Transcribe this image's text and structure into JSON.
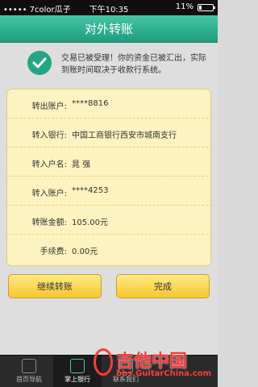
{
  "status_bar": {
    "carrier": "••••• 7color瓜子",
    "time": "下午10:35",
    "battery": "11%"
  },
  "header": {
    "title": "对外转账"
  },
  "notice": {
    "text": "交易已被受理！你的资金已被汇出，实际到账时间取决于收款行系统。"
  },
  "transfer": {
    "rows": [
      {
        "label": "转出账户:",
        "value": "****8816"
      },
      {
        "label": "转入银行:",
        "value": "中国工商银行西安市城南支行"
      },
      {
        "label": "转入户名:",
        "value": "晁 强"
      },
      {
        "label": "转入账户:",
        "value": "****4253"
      },
      {
        "label": "转账金额:",
        "value": "105.00元"
      },
      {
        "label": "手续费:",
        "value": "0.00元"
      }
    ]
  },
  "buttons": {
    "continue_label": "继续转账",
    "done_label": "完成"
  },
  "tabbar": {
    "items": [
      {
        "label": "首页导航"
      },
      {
        "label": "掌上银行"
      },
      {
        "label": "联系我们"
      }
    ]
  },
  "watermark": {
    "brand": "吉他中国",
    "url": "bbs.GuitarChina.com"
  },
  "colors": {
    "header": "#1f9d7e",
    "card_bg": "#fdf3c0",
    "button": "#f7c82e"
  }
}
